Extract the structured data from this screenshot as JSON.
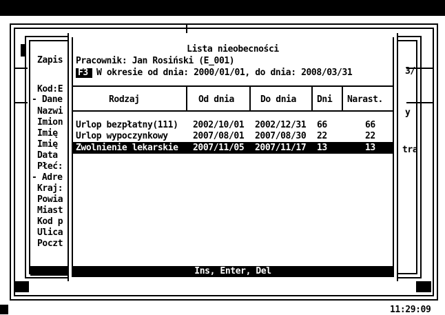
{
  "background_form": {
    "title": "Zapis",
    "right_fragment": "3/",
    "kod_label": "Kod:E",
    "fields": [
      "- Dane",
      "Nazwi",
      "Imion",
      "Imię",
      "Imię",
      "Data",
      "Płeć:",
      "- Adre",
      "Kraj:",
      "Powia",
      "Miast",
      "Kod p",
      "Ulica",
      "Poczt"
    ],
    "right_y": "y",
    "right_tra": "tra"
  },
  "dialog": {
    "title": "Lista nieobecności",
    "employee": "Pracownik: Jan Rosiński (E_001)",
    "f3_key": "F3",
    "period": "W okresie od dnia: 2000/01/01, do dnia: 2008/03/31",
    "columns": [
      "Rodzaj",
      "Od dnia",
      "Do dnia",
      "Dni",
      "Narast."
    ],
    "rows": [
      {
        "type": "Urlop bezpłatny(111)",
        "from": "2002/10/01",
        "to": "2002/12/31",
        "days": "66",
        "cumulative": "66"
      },
      {
        "type": "Urlop wypoczynkowy",
        "from": "2007/08/01",
        "to": "2007/08/30",
        "days": "22",
        "cumulative": "22"
      },
      {
        "type": "Zwolnienie lekarskie",
        "from": "2007/11/05",
        "to": "2007/11/17",
        "days": "13",
        "cumulative": "13"
      }
    ],
    "selected_row": 2,
    "status_keys": "Ins, Enter, Del"
  },
  "clock": "11:29:09",
  "colors": {
    "background": "#ffffff",
    "foreground": "#000000"
  }
}
